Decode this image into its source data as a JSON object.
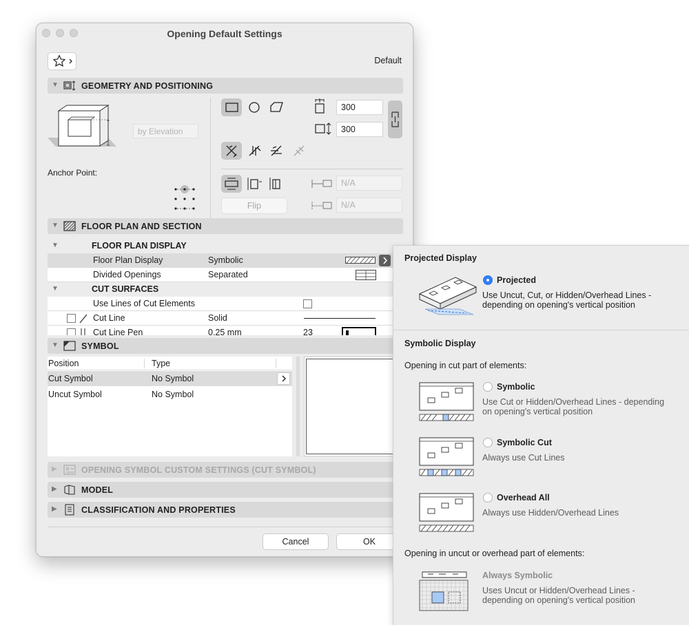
{
  "window": {
    "title": "Opening Default Settings",
    "favorites_label": "Default"
  },
  "geometry": {
    "title": "GEOMETRY AND POSITIONING",
    "by_elevation_placeholder": "by Elevation",
    "anchor_label": "Anchor Point:",
    "width": "300",
    "height": "300",
    "na1": "N/A",
    "na2": "N/A",
    "flip": "Flip"
  },
  "floor_plan": {
    "title": "FLOOR PLAN AND SECTION",
    "display_group": "FLOOR PLAN DISPLAY",
    "rows": [
      {
        "label": "Floor Plan Display",
        "value": "Symbolic"
      },
      {
        "label": "Divided Openings",
        "value": "Separated"
      }
    ],
    "cut_group": "CUT SURFACES",
    "use_lines_label": "Use Lines of Cut Elements",
    "cut_line_label": "Cut Line",
    "cut_line_value": "Solid",
    "cut_line_pen_label": "Cut Line Pen",
    "cut_line_pen_value": "0.25 mm",
    "cut_line_pen_number": "23"
  },
  "symbol": {
    "title": "SYMBOL",
    "col_position": "Position",
    "col_type": "Type",
    "rows": [
      {
        "position": "Cut Symbol",
        "type": "No Symbol"
      },
      {
        "position": "Uncut Symbol",
        "type": "No Symbol"
      }
    ]
  },
  "collapsed_sections": [
    "OPENING SYMBOL CUSTOM SETTINGS (CUT SYMBOL)",
    "MODEL",
    "CLASSIFICATION AND PROPERTIES"
  ],
  "buttons": {
    "cancel": "Cancel",
    "ok": "OK"
  },
  "popup": {
    "projected_title": "Projected Display",
    "projected": {
      "label": "Projected",
      "desc1": "Use Uncut, Cut, or Hidden/Overhead Lines -",
      "desc2": "depending on opening's vertical position",
      "selected": true
    },
    "symbolic_title": "Symbolic Display",
    "cut_part_label": "Opening in cut part of elements:",
    "options": [
      {
        "label": "Symbolic",
        "desc1": "Use Cut or Hidden/Overhead Lines - depending",
        "desc2": "on opening's vertical position"
      },
      {
        "label": "Symbolic Cut",
        "desc1": "Always use Cut Lines",
        "desc2": ""
      },
      {
        "label": "Overhead All",
        "desc1": "Always use Hidden/Overhead Lines",
        "desc2": ""
      }
    ],
    "uncut_part_label": "Opening in uncut or overhead part of elements:",
    "always": {
      "label": "Always Symbolic",
      "desc1": "Uses Uncut or Hidden/Overhead Lines -",
      "desc2": "depending on opening's vertical position"
    }
  },
  "colors": {
    "accent": "#2f7cf6",
    "highlight": "#a9c9f5"
  }
}
